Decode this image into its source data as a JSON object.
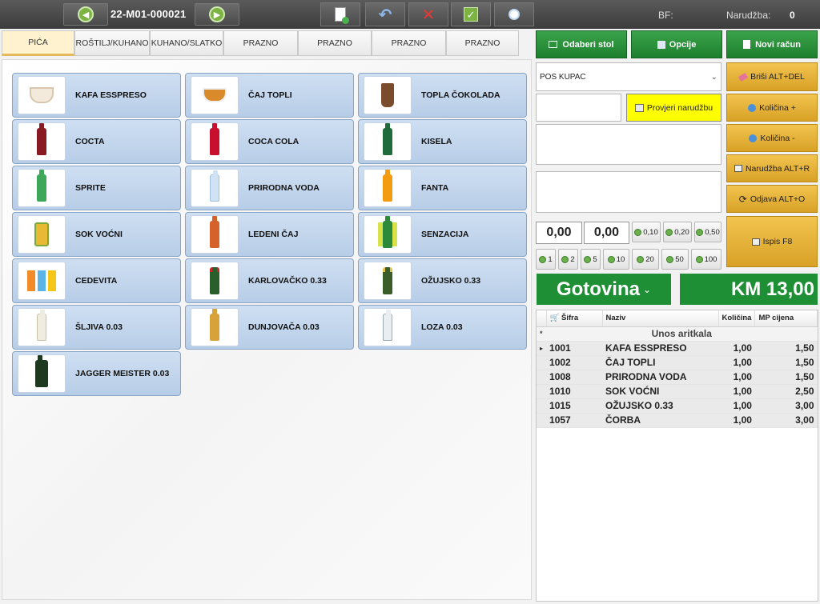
{
  "topbar": {
    "doc_number": "22-M01-000021",
    "bf_label": "BF:",
    "narudzba_label": "Narudžba:",
    "narudzba_value": "0"
  },
  "tabs": [
    "PIĆA",
    "ROŠTILJ/KUHANO",
    "KUHANO/SLATKO",
    "PRAZNO",
    "PRAZNO",
    "PRAZNO",
    "PRAZNO"
  ],
  "products": [
    {
      "label": "KAFA ESSPRESO",
      "icon": "coffee-icon"
    },
    {
      "label": "ČAJ TOPLI",
      "icon": "tea-icon"
    },
    {
      "label": "TOPLA ČOKOLADA",
      "icon": "hot-chocolate-icon"
    },
    {
      "label": "COCTA",
      "icon": "bottle-icon"
    },
    {
      "label": "COCA COLA",
      "icon": "bottle-icon"
    },
    {
      "label": "KISELA",
      "icon": "bottle-icon"
    },
    {
      "label": "SPRITE",
      "icon": "bottle-icon"
    },
    {
      "label": "PRIRODNA VODA",
      "icon": "bottle-icon"
    },
    {
      "label": "FANTA",
      "icon": "bottle-icon"
    },
    {
      "label": "SOK VOĆNI",
      "icon": "juice-icon"
    },
    {
      "label": "LEDENI ČAJ",
      "icon": "bottle-icon"
    },
    {
      "label": "SENZACIJA",
      "icon": "bottle-icon"
    },
    {
      "label": "CEDEVITA",
      "icon": "cedevita-icon"
    },
    {
      "label": "KARLOVAČKO 0.33",
      "icon": "beer-bottle-icon"
    },
    {
      "label": "OŽUJSKO 0.33",
      "icon": "beer-bottle-icon"
    },
    {
      "label": "ŠLJIVA 0.03",
      "icon": "spirit-bottle-icon"
    },
    {
      "label": "DUNJOVAČA 0.03",
      "icon": "spirit-bottle-icon"
    },
    {
      "label": "LOZA 0.03",
      "icon": "spirit-bottle-icon"
    },
    {
      "label": "JAGGER MEISTER 0.03",
      "icon": "spirit-bottle-icon"
    }
  ],
  "right": {
    "odaberi_stol": "Odaberi stol",
    "opcije": "Opcije",
    "novi_racun": "Novi račun",
    "customer": "POS KUPAC",
    "provjeri": "Provjeri narudžbu",
    "brisi": "Briši ALT+DEL",
    "kolicina_plus": "Količina +",
    "kolicina_minus": "Količina -",
    "narudzba": "Narudžba ALT+R",
    "odjava": "Odjava ALT+O",
    "ispis": "Ispis F8",
    "amount1": "0,00",
    "amount2": "0,00",
    "coins": [
      "0,10",
      "0,20",
      "0,50",
      "1",
      "2",
      "5",
      "10",
      "20",
      "50",
      "100"
    ],
    "payment_method": "Gotovina",
    "total": "KM 13,00"
  },
  "table": {
    "headers": [
      "Šifra",
      "Naziv",
      "Količina",
      "MP cijena"
    ],
    "new_row": "Unos aritkala",
    "rows": [
      [
        "1001",
        "KAFA ESSPRESO",
        "1,00",
        "1,50"
      ],
      [
        "1002",
        "ČAJ TOPLI",
        "1,00",
        "1,50"
      ],
      [
        "1008",
        "PRIRODNA VODA",
        "1,00",
        "1,50"
      ],
      [
        "1010",
        "SOK VOĆNI",
        "1,00",
        "2,50"
      ],
      [
        "1015",
        "OŽUJSKO 0.33",
        "1,00",
        "3,00"
      ],
      [
        "1057",
        "ČORBA",
        "1,00",
        "3,00"
      ]
    ]
  },
  "colors": {
    "green": "#1f8f36",
    "gold": "#e2b13a",
    "tile": "#c3d6ee"
  }
}
